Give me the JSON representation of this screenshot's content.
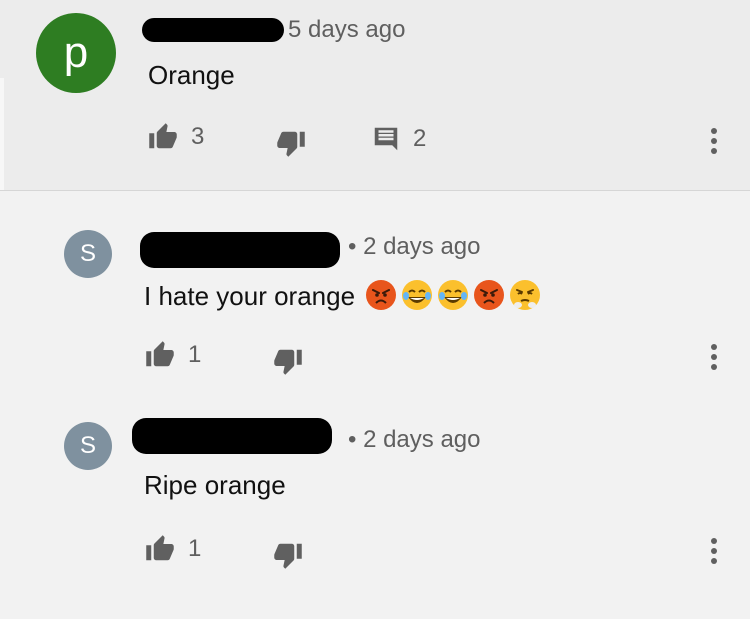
{
  "comments": [
    {
      "avatar_letter": "p",
      "avatar_color": "#2e7d22",
      "timestamp": "5 days ago",
      "text": "Orange",
      "likes": "3",
      "replies": "2"
    },
    {
      "avatar_letter": "S",
      "avatar_color": "#7f919f",
      "timestamp": "• 2 days ago",
      "text": "I hate your orange",
      "emojis": [
        "angry-face",
        "laughing-tears-face",
        "laughing-tears-face",
        "angry-face",
        "steam-nose-face"
      ],
      "likes": "1"
    },
    {
      "avatar_letter": "S",
      "avatar_color": "#7f919f",
      "timestamp": "• 2 days ago",
      "text": "Ripe orange",
      "likes": "1"
    }
  ]
}
